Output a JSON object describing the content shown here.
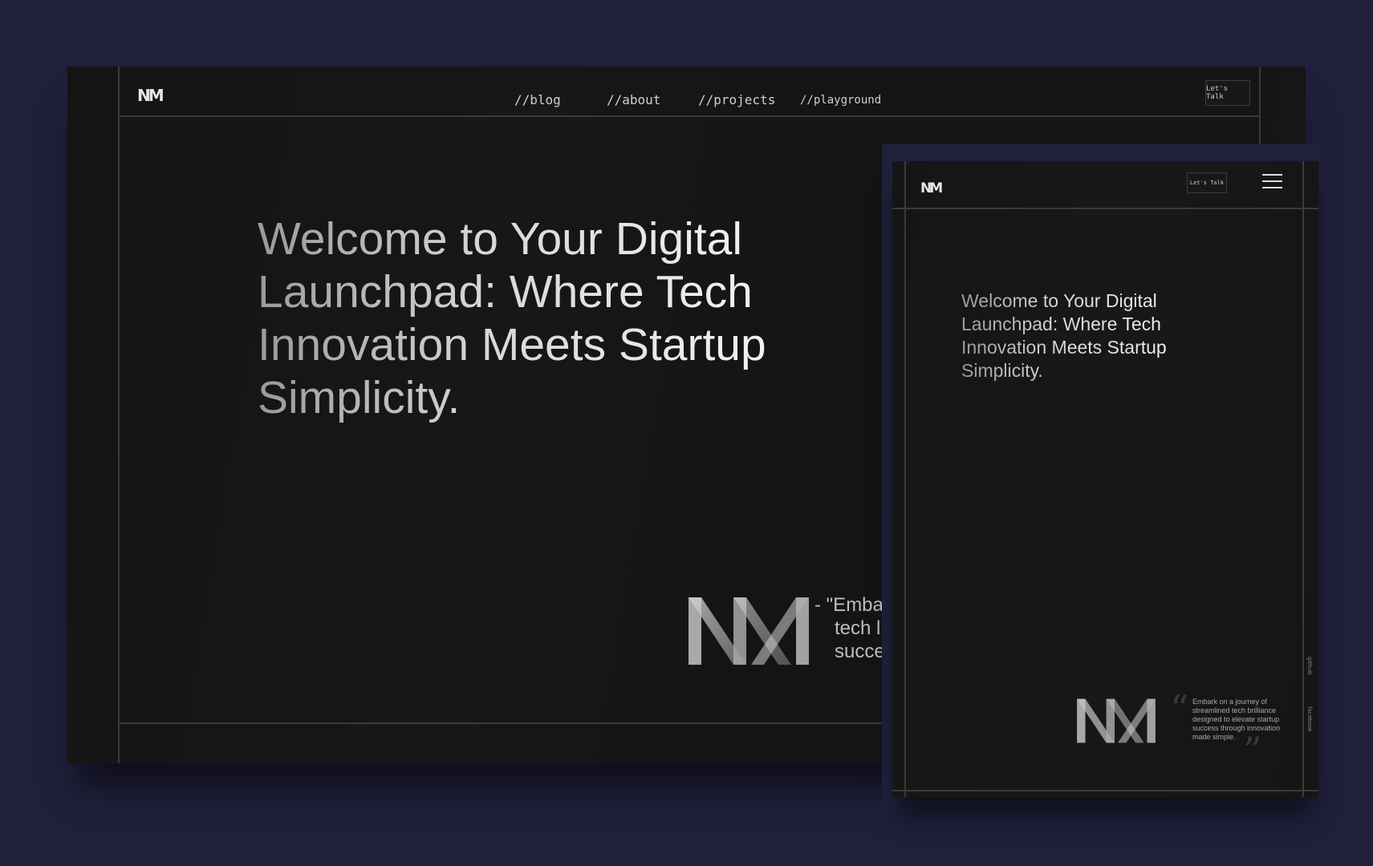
{
  "desktop": {
    "logo": "NM",
    "nav": [
      {
        "label": "//blog"
      },
      {
        "label": "//about"
      },
      {
        "label": "//projects"
      },
      {
        "label": "//playground"
      }
    ],
    "cta_label": "Let's Talk",
    "headline_lines": [
      "Welcome to Your Digital",
      "Launchpad: Where Tech",
      "Innovation Meets Startup",
      "Simplicity."
    ],
    "quote_lines": [
      "- \"Emba",
      "tech l",
      "succe"
    ]
  },
  "mobile": {
    "logo": "NM",
    "cta_label": "Let's Talk",
    "headline_lines": [
      "Welcome to Your Digital",
      "Launchpad: Where Tech",
      "Innovation Meets Startup",
      "Simplicity."
    ],
    "quote_lines": [
      "Embark on a journey of",
      "streamlined tech brilliance",
      "designed to elevate startup",
      "success through innovation",
      "made simple."
    ],
    "side_links": [
      "github",
      "facebook"
    ]
  },
  "colors": {
    "backdrop": "#20203d",
    "panel": "#151515",
    "line": "#3a3a3a",
    "text": "#d8d8d8"
  },
  "icons": [
    "nm-logo",
    "hamburger-menu-icon",
    "quote-open-icon",
    "quote-close-icon"
  ]
}
